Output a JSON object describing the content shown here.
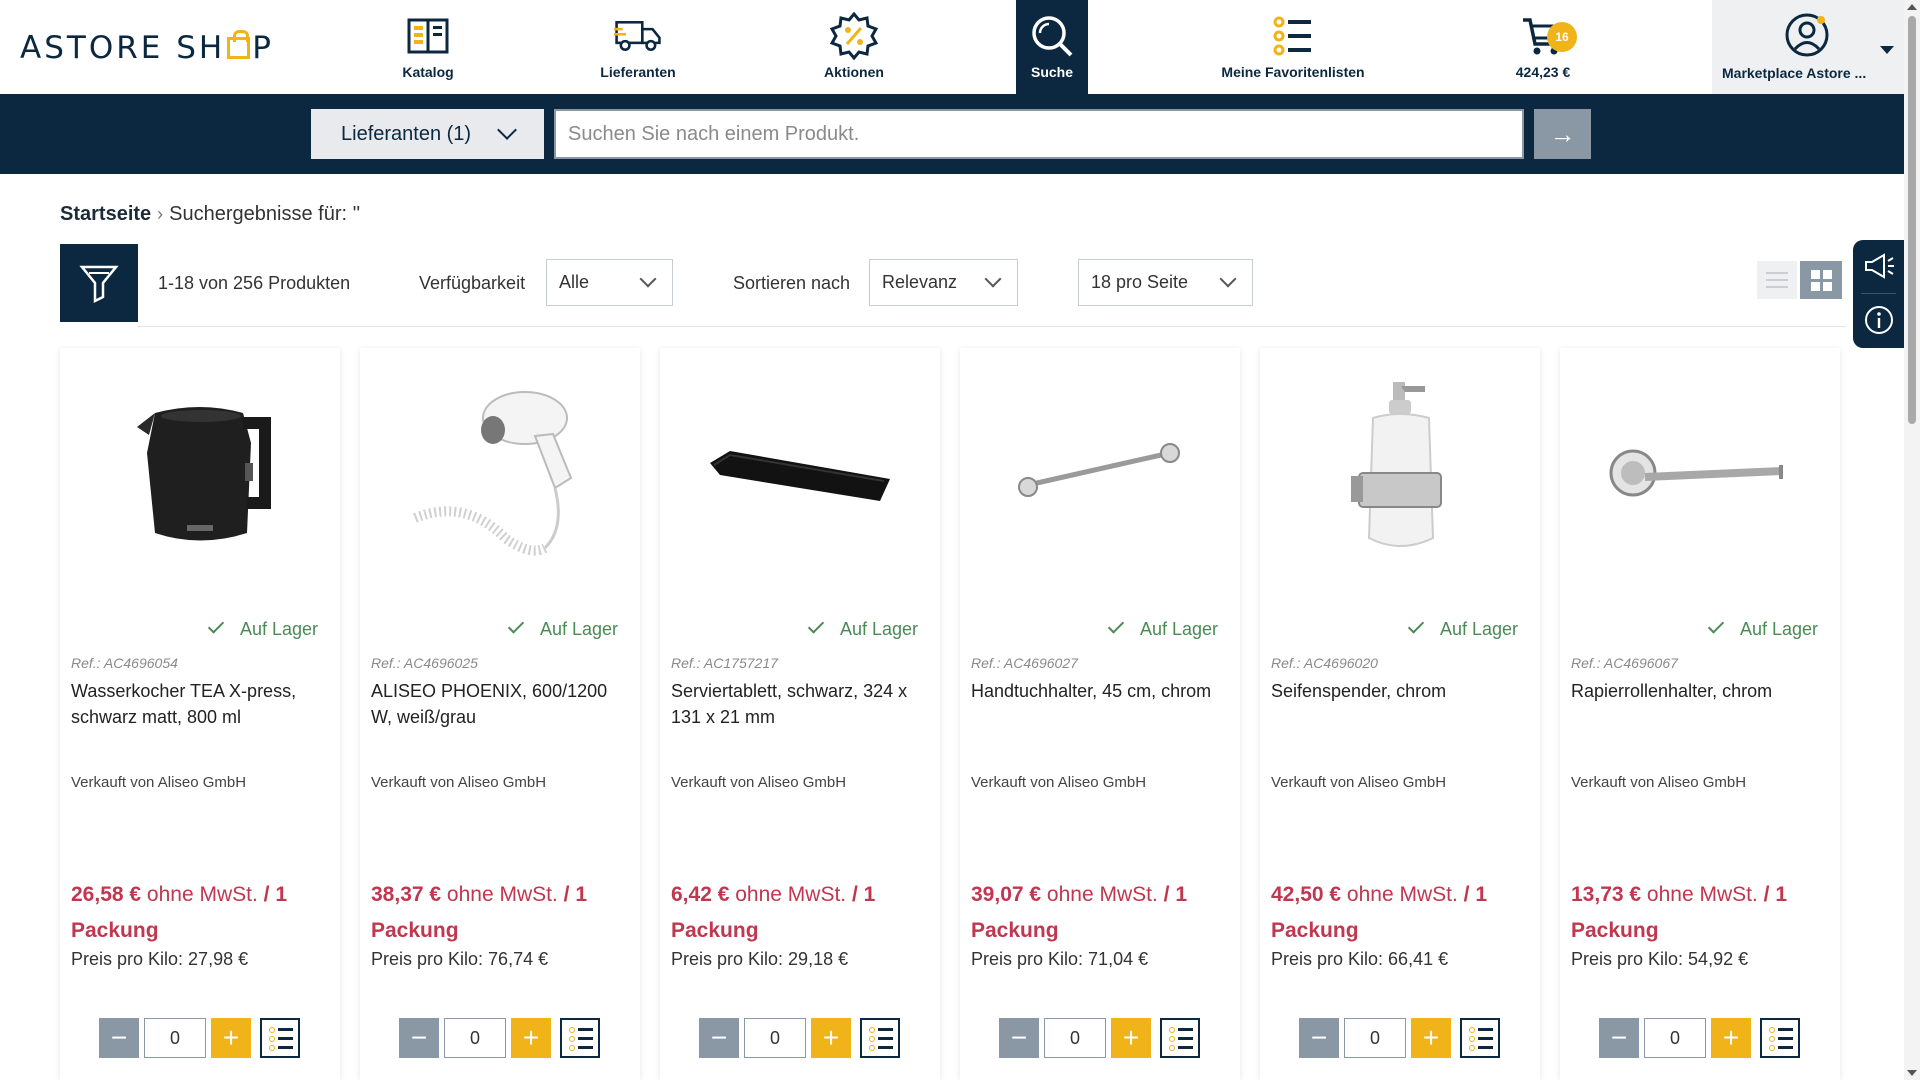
{
  "header": {
    "logo_text_1": "ASTORE SH",
    "logo_text_2": "P",
    "nav": [
      {
        "label": "Katalog",
        "icon": "catalog-book-icon"
      },
      {
        "label": "Lieferanten",
        "icon": "delivery-truck-icon"
      },
      {
        "label": "Aktionen",
        "icon": "discount-badge-icon"
      },
      {
        "label": "Suche",
        "icon": "search-icon",
        "active": true
      },
      {
        "label": "Meine Favoritenlisten",
        "icon": "favorites-list-icon"
      },
      {
        "label": "424,23 €",
        "icon": "cart-icon",
        "badge": "16"
      }
    ],
    "account_label": "Marketplace Astore ..."
  },
  "search": {
    "supplier_filter": "Lieferanten (1)",
    "placeholder": "Suchen Sie nach einem Produkt.",
    "go": "→"
  },
  "breadcrumb": {
    "home": "Startseite",
    "separator": "›",
    "current": "Suchergebnisse für: ''"
  },
  "toolbar": {
    "count": "1-18 von 256 Produkten",
    "availability_label": "Verfügbarkeit",
    "availability_value": "Alle",
    "sort_label": "Sortieren nach",
    "sort_value": "Relevanz",
    "per_page_value": "18 pro Seite"
  },
  "products": [
    {
      "stock": "Auf Lager",
      "ref": "Ref.: AC4696054",
      "name": "Wasserkocher TEA X-press, schwarz matt, 800 ml",
      "seller": "Verkauft von Aliseo GmbH",
      "price": "26,58 €",
      "tax": "ohne MwSt.",
      "unit": "/ 1 Packung",
      "ppk": "Preis pro Kilo: 27,98 €",
      "qty": "0",
      "image": "kettle"
    },
    {
      "stock": "Auf Lager",
      "ref": "Ref.: AC4696025",
      "name": "ALISEO PHOENIX, 600/1200 W, weiß/grau",
      "seller": "Verkauft von Aliseo GmbH",
      "price": "38,37 €",
      "tax": "ohne MwSt.",
      "unit": "/ 1 Packung",
      "ppk": "Preis pro Kilo: 76,74 €",
      "qty": "0",
      "image": "hairdryer"
    },
    {
      "stock": "Auf Lager",
      "ref": "Ref.: AC1757217",
      "name": "Serviertablett, schwarz, 324 x 131 x 21 mm",
      "seller": "Verkauft von Aliseo GmbH",
      "price": "6,42 €",
      "tax": "ohne MwSt.",
      "unit": "/ 1 Packung",
      "ppk": "Preis pro Kilo: 29,18 €",
      "qty": "0",
      "image": "tray"
    },
    {
      "stock": "Auf Lager",
      "ref": "Ref.: AC4696027",
      "name": "Handtuchhalter, 45 cm, chrom",
      "seller": "Verkauft von Aliseo GmbH",
      "price": "39,07 €",
      "tax": "ohne MwSt.",
      "unit": "/ 1 Packung",
      "ppk": "Preis pro Kilo: 71,04 €",
      "qty": "0",
      "image": "towelbar"
    },
    {
      "stock": "Auf Lager",
      "ref": "Ref.: AC4696020",
      "name": "Seifenspender, chrom",
      "seller": "Verkauft von Aliseo GmbH",
      "price": "42,50 €",
      "tax": "ohne MwSt.",
      "unit": "/ 1 Packung",
      "ppk": "Preis pro Kilo: 66,41 €",
      "qty": "0",
      "image": "soap"
    },
    {
      "stock": "Auf Lager",
      "ref": "Ref.: AC4696067",
      "name": "Rapierrollenhalter, chrom",
      "seller": "Verkauft von Aliseo GmbH",
      "price": "13,73 €",
      "tax": "ohne MwSt.",
      "unit": "/ 1 Packung",
      "ppk": "Preis pro Kilo: 54,92 €",
      "qty": "0",
      "image": "paperholder"
    }
  ],
  "colors": {
    "navy": "#0b2840",
    "accent_yellow": "#f0b31a",
    "price_red": "#c0374f",
    "stock_green": "#4a8a55",
    "slate": "#8a98a6"
  }
}
